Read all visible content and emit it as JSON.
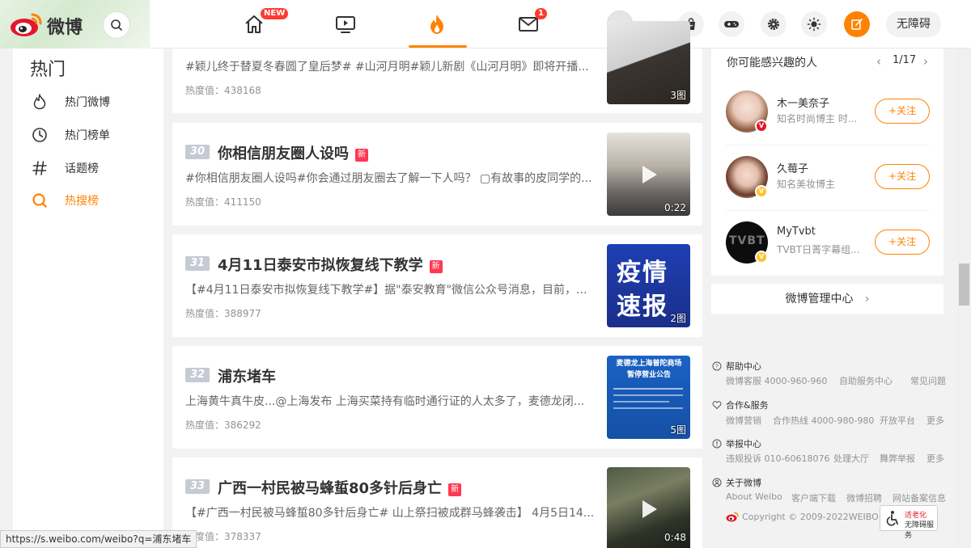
{
  "brand": {
    "name": "微博"
  },
  "header": {
    "home_badge": "NEW",
    "mail_badge": "1",
    "accessibility_label": "无障碍"
  },
  "sidebar": {
    "title": "热门",
    "items": [
      {
        "label": "热门微博"
      },
      {
        "label": "热门榜单"
      },
      {
        "label": "话题榜"
      },
      {
        "label": "热搜榜",
        "active": true
      }
    ]
  },
  "feed": [
    {
      "rank": "",
      "title": "",
      "is_new": false,
      "summary": "#颖儿终于替夏冬春圆了皇后梦# #山河月明#颖儿新剧《山河月明》即将开播...",
      "heat": "热度值：438168",
      "thumb_caption": "3图",
      "video": false
    },
    {
      "rank": "30",
      "title": "你相信朋友圈人设吗",
      "is_new": true,
      "summary": "#你相信朋友圈人设吗#你会通过朋友圈去了解一下人吗？ ▢有故事的皮同学的...",
      "heat": "热度值：411150",
      "thumb_caption": "0:22",
      "video": true
    },
    {
      "rank": "31",
      "title": "4月11日泰安市拟恢复线下教学",
      "is_new": true,
      "summary": "【#4月11日泰安市拟恢复线下教学#】据\"泰安教育\"微信公众号消息，目前，...",
      "heat": "热度值：388977",
      "thumb_caption": "2图",
      "thumb_text_1": "疫情",
      "thumb_text_2": "速报",
      "video": false
    },
    {
      "rank": "32",
      "title": "浦东堵车",
      "is_new": false,
      "summary": "上海黄牛真牛皮...@上海发布 上海买菜持有临时通行证的人太多了，麦德龙闭...",
      "heat": "热度值：386292",
      "thumb_caption": "5图",
      "thumb_text_1": "麦德龙上海普陀商场",
      "thumb_text_2": "暂停营业公告",
      "video": false
    },
    {
      "rank": "33",
      "title": "广西一村民被马蜂蜇80多针后身亡",
      "is_new": true,
      "summary": "【#广西一村民被马蜂蜇80多针后身亡# 山上祭扫被成群马蜂袭击】 4月5日14...",
      "heat": "热度值：378337",
      "thumb_caption": "0:48",
      "video": true
    }
  ],
  "new_tag": "新",
  "recommend": {
    "title": "你可能感兴趣的人",
    "pager": "1/17",
    "follow_label": "+关注",
    "users": [
      {
        "name": "木一美奈子",
        "desc": "知名时尚博主 时...",
        "badge_color": "#e6162d"
      },
      {
        "name": "久莓子",
        "desc": "知名美妆博主",
        "badge_color": "#ffc12e"
      },
      {
        "name": "MyTvbt",
        "desc": "TVBT日菁字幕组...",
        "badge_color": "#ffc12e"
      }
    ]
  },
  "admin_center": "微博管理中心",
  "footer": {
    "help": {
      "title": "帮助中心",
      "links": [
        "微博客服 4000-960-960",
        "自助服务中心",
        "常见问题"
      ]
    },
    "coop": {
      "title": "合作&服务",
      "links": [
        "微博营销",
        "合作热线 4000-980-980",
        "开放平台",
        "更多"
      ]
    },
    "report": {
      "title": "举报中心",
      "links": [
        "违规投诉 010-60618076",
        "处理大厅",
        "舞弊举报",
        "更多"
      ]
    },
    "about": {
      "title": "关于微博",
      "links": [
        "About Weibo",
        "客户端下载",
        "微博招聘",
        "网站备案信息"
      ]
    },
    "copyright": "Copyright © 2009-2022WEIBO",
    "a11y_badge_line1": "适老化",
    "a11y_badge_line2": "无障碍服务"
  },
  "status_url": "https://s.weibo.com/weibo?q=浦东堵车"
}
